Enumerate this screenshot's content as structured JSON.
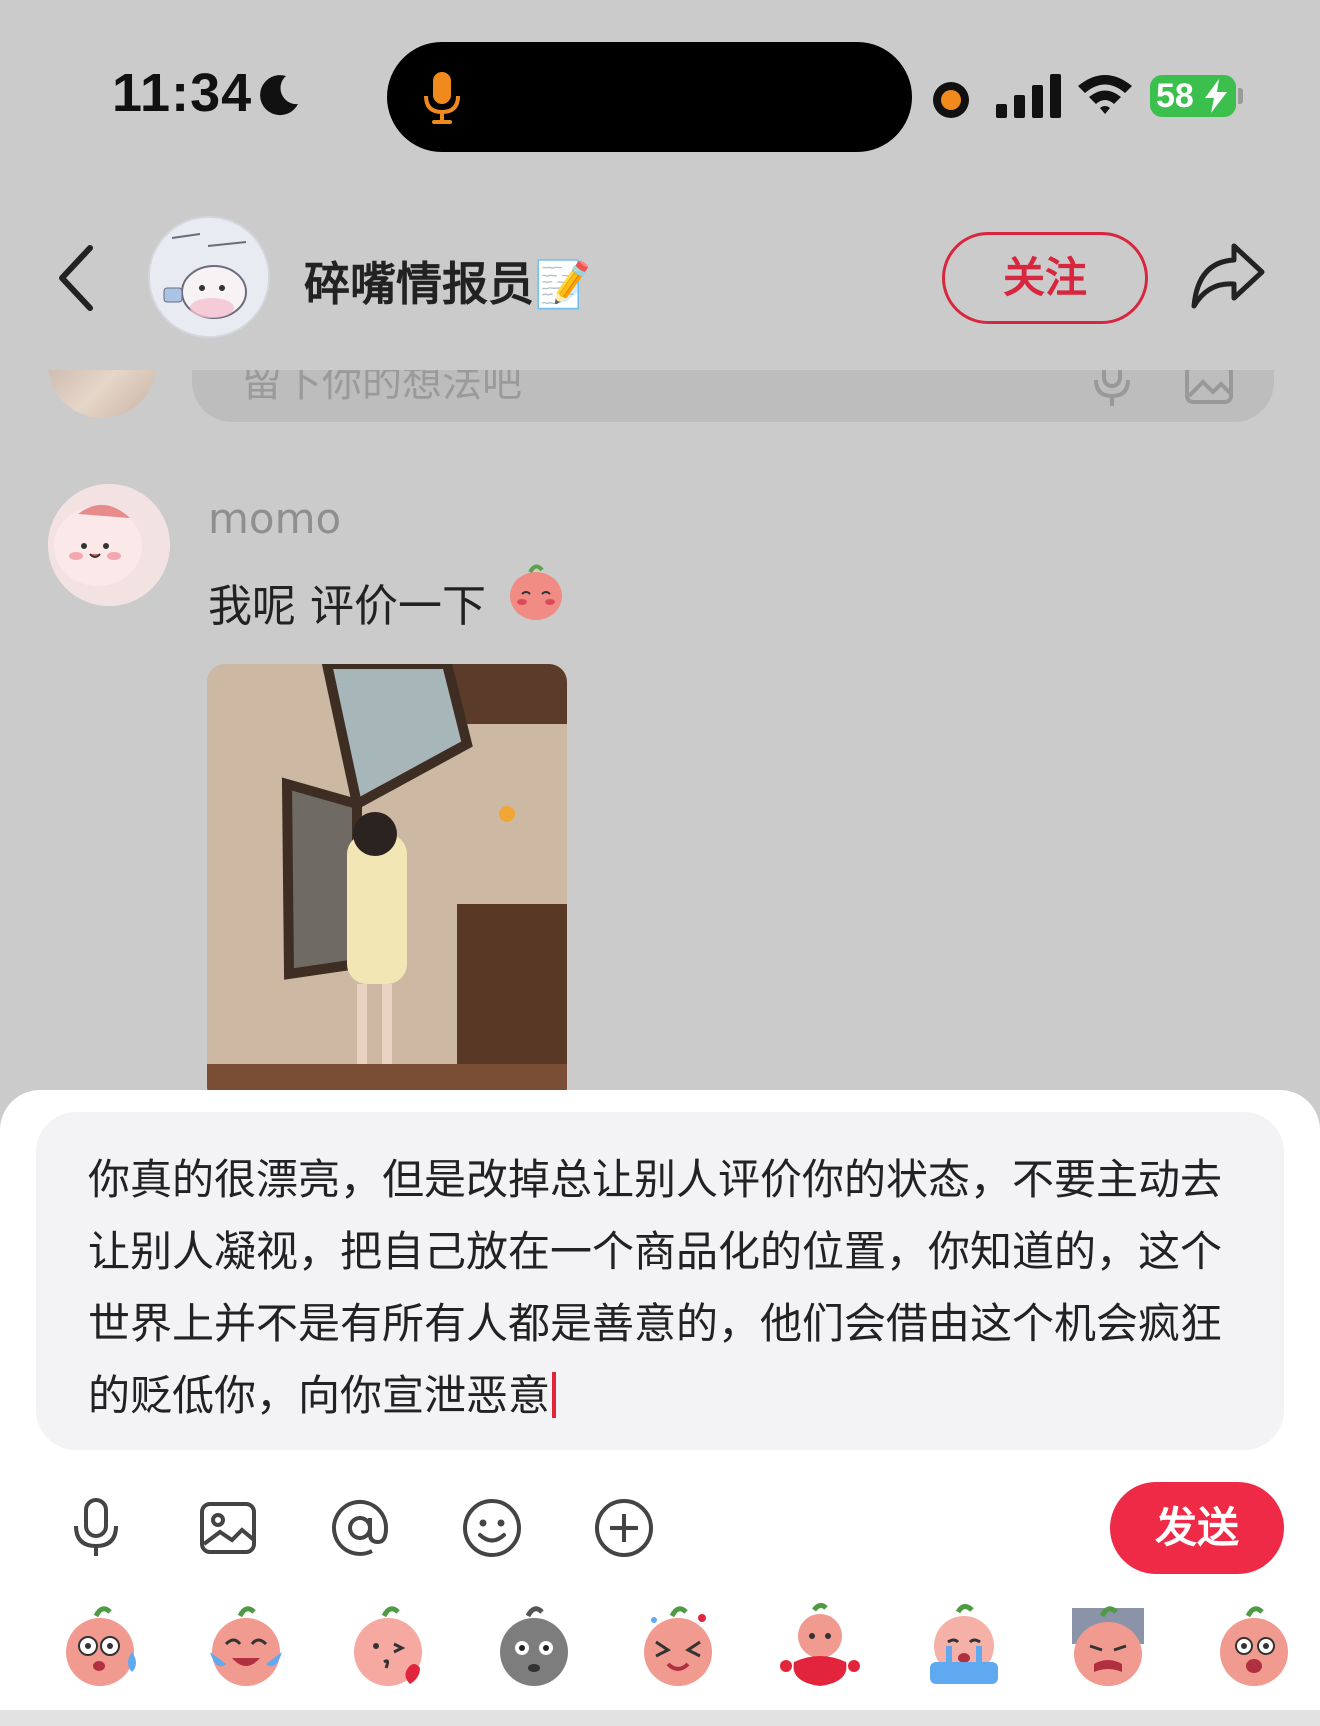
{
  "status_bar": {
    "time": "11:34",
    "battery": "58",
    "icons": [
      "moon-icon",
      "microphone-icon",
      "recording-dot",
      "cellular-signal-icon",
      "wifi-icon",
      "battery-icon"
    ]
  },
  "header": {
    "author_name": "碎嘴情报员📝",
    "follow_label": "关注"
  },
  "feed": {
    "reply_placeholder": "留下你的想法吧",
    "comment": {
      "user": "momo",
      "text": "我呢 评价一下"
    }
  },
  "composer": {
    "text": "你真的很漂亮，但是改掉总让别人评价你的状态，不要主动去让别人凝视，把自己放在一个商品化的位置，你知道的，这个世界上并不是有所有人都是善意的，他们会借由这个机会疯狂的贬低你，向你宣泄恶意",
    "send_label": "发送",
    "tools": [
      "voice-icon",
      "image-icon",
      "mention-icon",
      "emoji-icon",
      "add-icon"
    ],
    "stickers": [
      "sticker-shocked",
      "sticker-laugh-cry",
      "sticker-kiss",
      "sticker-gray-stone",
      "sticker-dizzy",
      "sticker-red-body",
      "sticker-crying-waterfall",
      "sticker-disgusted",
      "sticker-surprised"
    ]
  },
  "colors": {
    "accent_red": "#ef2a47",
    "follow_red": "#d7263d",
    "battery_green": "#3bbf4d",
    "mic_orange": "#f08a1c"
  }
}
